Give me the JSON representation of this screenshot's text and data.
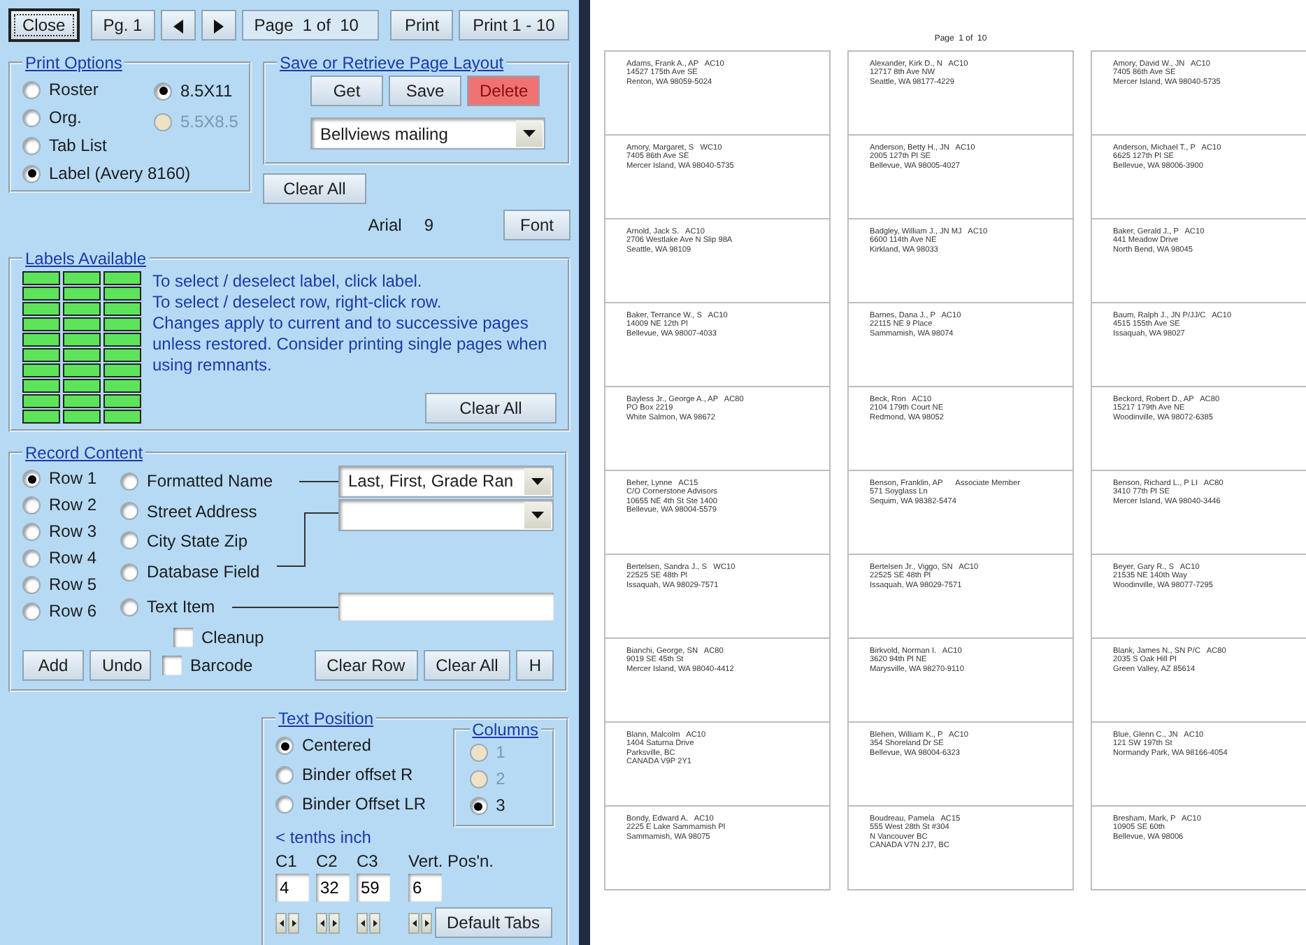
{
  "toolbar": {
    "buttons": [
      {
        "label": "Close",
        "focused": true
      },
      {
        "label": "Pg. 1",
        "focused": false
      }
    ],
    "page_display": "Page  1 of  10",
    "print_buttons": [
      "Print",
      "Print 1 - 10"
    ]
  },
  "print_options": {
    "title": "Print Options",
    "formats": [
      {
        "label": "Roster",
        "selected": false
      },
      {
        "label": "Org.",
        "selected": false
      },
      {
        "label": "Tab List",
        "selected": false
      },
      {
        "label": "Label (Avery 8160)",
        "selected": true
      }
    ],
    "paper_sizes": [
      {
        "label": "8.5X11",
        "selected": true,
        "disabled": false
      },
      {
        "label": "5.5X8.5",
        "selected": false,
        "disabled": true
      }
    ]
  },
  "page_layout": {
    "title": "Save or Retrieve Page Layout",
    "buttons": [
      {
        "label": "Get",
        "kind": "normal"
      },
      {
        "label": "Save",
        "kind": "normal"
      },
      {
        "label": "Delete",
        "kind": "danger"
      }
    ],
    "layout_value": "Bellviews mailing"
  },
  "clear_all_button": "Clear All",
  "font": {
    "name": "Arial",
    "size": "9",
    "button": "Font"
  },
  "labels_available": {
    "title": "Labels Available",
    "rows": [
      {
        "cells": [
          {
            "selected": true
          },
          {
            "selected": true
          },
          {
            "selected": true
          }
        ]
      },
      {
        "cells": [
          {
            "selected": true
          },
          {
            "selected": true
          },
          {
            "selected": true
          }
        ]
      },
      {
        "cells": [
          {
            "selected": true
          },
          {
            "selected": true
          },
          {
            "selected": true
          }
        ]
      },
      {
        "cells": [
          {
            "selected": true
          },
          {
            "selected": true
          },
          {
            "selected": true
          }
        ]
      },
      {
        "cells": [
          {
            "selected": true
          },
          {
            "selected": true
          },
          {
            "selected": true
          }
        ]
      },
      {
        "cells": [
          {
            "selected": true
          },
          {
            "selected": true
          },
          {
            "selected": true
          }
        ]
      },
      {
        "cells": [
          {
            "selected": true
          },
          {
            "selected": true
          },
          {
            "selected": true
          }
        ]
      },
      {
        "cells": [
          {
            "selected": true
          },
          {
            "selected": true
          },
          {
            "selected": true
          }
        ]
      },
      {
        "cells": [
          {
            "selected": true
          },
          {
            "selected": true
          },
          {
            "selected": true
          }
        ]
      },
      {
        "cells": [
          {
            "selected": true
          },
          {
            "selected": true
          },
          {
            "selected": true
          }
        ]
      }
    ],
    "instructions": [
      "To select / deselect label, click label.",
      "To select / deselect row, right-click row.",
      "Changes apply to current and to successive pages unless restored. Consider printing single pages when using remnants."
    ],
    "button": "Clear All"
  },
  "record_content": {
    "title": "Record Content",
    "rows": [
      {
        "label": "Row 1",
        "selected": true
      },
      {
        "label": "Row 2",
        "selected": false
      },
      {
        "label": "Row 3",
        "selected": false
      },
      {
        "label": "Row 4",
        "selected": false
      },
      {
        "label": "Row 5",
        "selected": false
      },
      {
        "label": "Row 6",
        "selected": false
      }
    ],
    "fields": [
      {
        "label": "Formatted Name",
        "selected": false
      },
      {
        "label": "Street Address",
        "selected": false
      },
      {
        "label": "City State Zip",
        "selected": false
      },
      {
        "label": "Database Field",
        "selected": false
      },
      {
        "label": "Text Item",
        "selected": false
      }
    ],
    "name_format": "Last, First, Grade Ran",
    "checkboxes": [
      {
        "label": "Cleanup",
        "checked": false
      },
      {
        "label": "Barcode",
        "checked": false
      }
    ],
    "buttons_left": [
      "Add",
      "Undo"
    ],
    "buttons_right": [
      "Clear Row",
      "Clear All",
      "H"
    ]
  },
  "text_position": {
    "title": "Text Position",
    "alignments": [
      {
        "label": "Centered",
        "selected": true
      },
      {
        "label": "Binder offset R",
        "selected": false
      },
      {
        "label": "Binder Offset LR",
        "selected": false
      }
    ],
    "columns": {
      "title": "Columns",
      "options": [
        {
          "label": "1",
          "selected": false,
          "disabled": true
        },
        {
          "label": "2",
          "selected": false,
          "disabled": true
        },
        {
          "label": "3",
          "selected": true,
          "disabled": false
        }
      ]
    },
    "hint": "< tenths inch",
    "offsets": [
      {
        "label": "C1",
        "value": "4"
      },
      {
        "label": "C2",
        "value": "32"
      },
      {
        "label": "C3",
        "value": "59"
      },
      {
        "label": "Vert. Pos'n.",
        "value": "6"
      }
    ],
    "button": "Default Tabs"
  },
  "preview": {
    "page_title": "Page  1 of  10",
    "labels": [
      {
        "lines": [
          "Adams, Frank A., AP   AC10",
          "14527 175th Ave SE",
          "Renton, WA 98059-5024"
        ]
      },
      {
        "lines": [
          "Alexander, Kirk D., N   AC10",
          "12717 8th Ave NW",
          "Seattle, WA 98177-4229"
        ]
      },
      {
        "lines": [
          "Amory, David W., JN   AC10",
          "7405 86th Ave SE",
          "Mercer Island, WA 98040-5735"
        ]
      },
      {
        "lines": [
          "Amory, Margaret, S   WC10",
          "7405 86th Ave SE",
          "Mercer Island, WA 98040-5735"
        ]
      },
      {
        "lines": [
          "Anderson, Betty H., JN   AC10",
          "2005 127th Pl SE",
          "Bellevue, WA 98005-4027"
        ]
      },
      {
        "lines": [
          "Anderson, Michael T., P   AC10",
          "6625 127th Pl SE",
          "Bellevue, WA 98006-3900"
        ]
      },
      {
        "lines": [
          "Arnold, Jack S.   AC10",
          "2706 Westlake Ave N Slip 98A",
          "Seattle, WA 98109"
        ]
      },
      {
        "lines": [
          "Badgley, William J., JN MJ   AC10",
          "6600 114th Ave NE",
          "Kirkland, WA 98033"
        ]
      },
      {
        "lines": [
          "Baker, Gerald J., P   AC10",
          "441 Meadow Drive",
          "North Bend, WA 98045"
        ]
      },
      {
        "lines": [
          "Baker, Terrance W., S   AC10",
          "14009 NE 12th Pl",
          "Bellevue, WA 98007-4033"
        ]
      },
      {
        "lines": [
          "Barnes, Dana J., P   AC10",
          "22115 NE 9 Place",
          "Sammamish, WA 98074"
        ]
      },
      {
        "lines": [
          "Baum, Ralph J., JN P/JJ/C   AC10",
          "4515 155th Ave SE",
          "Issaquah, WA 98027"
        ]
      },
      {
        "lines": [
          "Bayless Jr., George A., AP   AC80",
          "PO Box 2219",
          "White Salmon, WA 98672"
        ]
      },
      {
        "lines": [
          "Beck, Ron   AC10",
          "2104 179th Court NE",
          "Redmond, WA 98052"
        ]
      },
      {
        "lines": [
          "Beckord, Robert D., AP   AC80",
          "15217 179th Ave NE",
          "Woodinville, WA 98072-6385"
        ]
      },
      {
        "lines": [
          "Beher, Lynne   AC15",
          "C/O Cornerstone Advisors",
          "10655 NE 4th St Ste 1400",
          "Bellevue, WA 98004-5579"
        ]
      },
      {
        "lines": [
          "Benson, Franklin, AP      Associate Member",
          "571 Soyglass Ln",
          "Sequim, WA 98382-5474"
        ]
      },
      {
        "lines": [
          "Benson, Richard L., P LI   AC80",
          "3410 77th Pl SE",
          "Mercer Island, WA 98040-3446"
        ]
      },
      {
        "lines": [
          "Bertelsen, Sandra J., S   WC10",
          "22525 SE 48th Pl",
          "Issaquah, WA 98029-7571"
        ]
      },
      {
        "lines": [
          "Bertelsen Jr., Viggo, SN   AC10",
          "22525 SE 48th Pl",
          "Issaquah, WA 98029-7571"
        ]
      },
      {
        "lines": [
          "Beyer, Gary R., S   AC10",
          "21535 NE 140th Way",
          "Woodinville, WA 98077-7295"
        ]
      },
      {
        "lines": [
          "Bianchi, George, SN   AC80",
          "9019 SE 45th St",
          "Mercer Island, WA 98040-4412"
        ]
      },
      {
        "lines": [
          "Birkvold, Norman I.   AC10",
          "3620 94th Pl NE",
          "Marysville, WA 98270-9110"
        ]
      },
      {
        "lines": [
          "Blank, James N., SN P/C   AC80",
          "2035 S Oak Hill Pl",
          "Green Valley, AZ 85614"
        ]
      },
      {
        "lines": [
          "Blann, Malcolm   AC10",
          "1404 Saturna Drive",
          "Parksville, BC",
          "CANADA V9P 2Y1"
        ]
      },
      {
        "lines": [
          "Blehen, William K., P   AC10",
          "354 Shoreland Dr SE",
          "Bellevue, WA 98004-6323"
        ]
      },
      {
        "lines": [
          "Blue, Glenn C., JN   AC10",
          "121 SW 197th St",
          "Normandy Park, WA 98166-4054"
        ]
      },
      {
        "lines": [
          "Bondy, Edward A.   AC10",
          "2225 E Lake Sammamish Pl",
          "Sammamish, WA 98075"
        ]
      },
      {
        "lines": [
          "Boudreau, Pamela   AC15",
          "555 West 28th St #304",
          "N Vancouver BC",
          "CANADA V7N 2J7, BC"
        ]
      },
      {
        "lines": [
          "Bresham, Mark, P   AC10",
          "10905 SE 60th",
          "Bellevue, WA 98006"
        ]
      }
    ]
  }
}
